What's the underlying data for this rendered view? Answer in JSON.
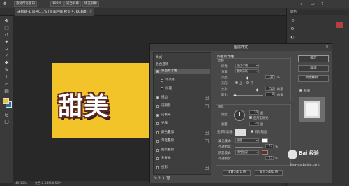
{
  "options_bar": {
    "tool_icon": "move-tool-icon",
    "btn1": "滚动所有窗口",
    "zoom": "100%",
    "btn2": "适合屏幕",
    "btn3": "填充屏幕"
  },
  "document": {
    "tab_title": "未标题-1 @ 40.1% (甜美店铺 拷贝 4, RGB/8)",
    "tab_close": "×",
    "canvas_text": "甜美"
  },
  "status": {
    "zoom": "40.13%",
    "doc_info": "文档:2.34M/8.50M"
  },
  "right_panel": {
    "tab_label": "颜色"
  },
  "dialog": {
    "title": "图层样式",
    "close": "×",
    "left": {
      "header_styles": "样式",
      "blend_options": "混合选项",
      "items": [
        {
          "label": "斜面和浮雕",
          "checked": true,
          "selected": true,
          "sub": false,
          "plus": false
        },
        {
          "label": "等高线",
          "checked": false,
          "selected": false,
          "sub": true,
          "plus": false
        },
        {
          "label": "纹理",
          "checked": false,
          "selected": false,
          "sub": true,
          "plus": false
        },
        {
          "label": "描边",
          "checked": true,
          "selected": false,
          "sub": false,
          "plus": true
        },
        {
          "label": "内阴影",
          "checked": false,
          "selected": false,
          "sub": false,
          "plus": true
        },
        {
          "label": "内发光",
          "checked": true,
          "selected": false,
          "sub": false,
          "plus": false
        },
        {
          "label": "光泽",
          "checked": false,
          "selected": false,
          "sub": false,
          "plus": false
        },
        {
          "label": "颜色叠加",
          "checked": false,
          "selected": false,
          "sub": false,
          "plus": true
        },
        {
          "label": "渐变叠加",
          "checked": false,
          "selected": false,
          "sub": false,
          "plus": true
        },
        {
          "label": "图案叠加",
          "checked": false,
          "selected": false,
          "sub": false,
          "plus": false
        },
        {
          "label": "外发光",
          "checked": false,
          "selected": false,
          "sub": false,
          "plus": false
        },
        {
          "label": "投影",
          "checked": false,
          "selected": false,
          "sub": false,
          "plus": true
        }
      ],
      "footer": "fx  ↑  ↓   🗑"
    },
    "mid": {
      "section_title": "斜面和浮雕",
      "structure_title": "结构",
      "style_label": "样式:",
      "style_value": "描边浮雕",
      "technique_label": "方法:",
      "technique_value": "雕刻清晰",
      "depth_label": "深度:",
      "depth_value": "157",
      "direction_label": "方向:",
      "direction_up": "上",
      "direction_down": "下",
      "size_label": "大小:",
      "size_value": "250",
      "soften_label": "软化:",
      "soften_value": "0",
      "unit_pct": "%",
      "unit_px": "像素",
      "shading_title": "阴影",
      "angle_label": "角度:",
      "angle_value": "120",
      "global_light_label": "使用全局光",
      "altitude_label": "高度:",
      "altitude_value": "30",
      "unit_deg": "度",
      "gloss_label": "光泽等高线:",
      "antialias_label": "消除锯齿",
      "highlight_label": "高光模式:",
      "highlight_value": "滤色",
      "opacity_label": "不透明度:",
      "opacity_value": "75",
      "shadow_label": "阴影模式:",
      "shadow_value": "线性加深",
      "shadow_opacity_label": "不透明度:",
      "shadow_opacity_value": "75",
      "set_default": "设置为默认值",
      "reset_default": "复位为默认值",
      "highlight_color": "#ffffff",
      "shadow_color": "#6b2a2a"
    },
    "right": {
      "ok": "确定",
      "cancel": "取消",
      "new_style": "新建样式...",
      "preview_label": "预览"
    }
  },
  "watermark": {
    "brand": "Bai 经验",
    "url": "jingyan.baidu.com"
  },
  "colors": {
    "canvas_bg": "#f3c32a",
    "text_outline": "#5b2a23"
  }
}
